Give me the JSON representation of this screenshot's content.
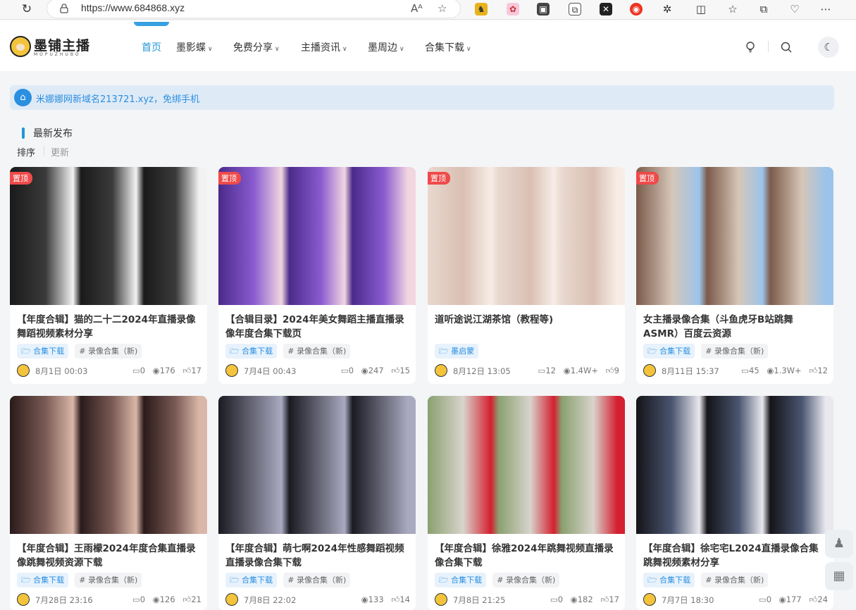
{
  "browser": {
    "url": "https://www.684868.xyz"
  },
  "site": {
    "logo_text": "墨铺主播",
    "logo_sub": "MOPUZHUBO",
    "nav": [
      {
        "label": "首页",
        "active": true
      },
      {
        "label": "墨影蝶",
        "active": false
      },
      {
        "label": "免费分享",
        "active": false
      },
      {
        "label": "主播资讯",
        "active": false
      },
      {
        "label": "墨周边",
        "active": false
      },
      {
        "label": "合集下载",
        "active": false
      }
    ]
  },
  "notice": "米娜娜网新域名213721.xyz，免绑手机",
  "section": {
    "title": "最新发布",
    "sort_active": "排序",
    "sort_other": "更新"
  },
  "pin_label": "置顶",
  "cards": [
    {
      "title": "【年度合辑】猫的二十二2024年直播录像舞蹈视频素材分享",
      "pinned": true,
      "cat": "合集下载",
      "tag": "# 录像合集（新)",
      "date": "8月1日 00:03",
      "comments": "0",
      "views": "176",
      "likes": "17"
    },
    {
      "title": "【合辑目录】2024年美女舞蹈主播直播录像年度合集下载页",
      "pinned": true,
      "cat": "合集下载",
      "tag": "# 录像合集（新)",
      "date": "7月4日 00:43",
      "comments": "0",
      "views": "247",
      "likes": "15"
    },
    {
      "title": "道听途说江湖茶馆（教程等)",
      "pinned": true,
      "cat": "墨启蒙",
      "tag": "",
      "date": "8月12日 13:05",
      "comments": "12",
      "views": "1.4W+",
      "likes": "9"
    },
    {
      "title": "女主播录像合集（斗鱼虎牙B站跳舞ASMR）百度云资源",
      "pinned": true,
      "cat": "合集下载",
      "tag": "# 录像合集（新)",
      "date": "8月11日 15:37",
      "comments": "45",
      "views": "1.3W+",
      "likes": "12"
    },
    {
      "title": "【年度合辑】王雨檬2024年度合集直播录像跳舞视频资源下载",
      "pinned": false,
      "cat": "合集下载",
      "tag": "# 录像合集（新)",
      "date": "7月28日 23:16",
      "comments": "0",
      "views": "126",
      "likes": "21"
    },
    {
      "title": "【年度合辑】萌七啊2024年性感舞蹈视频直播录像合集下载",
      "pinned": false,
      "cat": "合集下载",
      "tag": "# 录像合集（新)",
      "date": "7月8日 22:02",
      "comments": "",
      "views": "133",
      "likes": "14"
    },
    {
      "title": "【年度合辑】徐雅2024年跳舞视频直播录像合集下载",
      "pinned": false,
      "cat": "合集下载",
      "tag": "# 录像合集（新)",
      "date": "7月8日 21:25",
      "comments": "0",
      "views": "182",
      "likes": "17"
    },
    {
      "title": "【年度合辑】徐宅宅L2024直播录像合集跳舞视频素材分享",
      "pinned": false,
      "cat": "合集下载",
      "tag": "# 录像合集（新)",
      "date": "7月7日 18:30",
      "comments": "0",
      "views": "177",
      "likes": "24"
    }
  ],
  "colors": {
    "accent": "#2196d8",
    "pin": "#ef4a4a",
    "notice_bg": "#dfeaf7"
  }
}
